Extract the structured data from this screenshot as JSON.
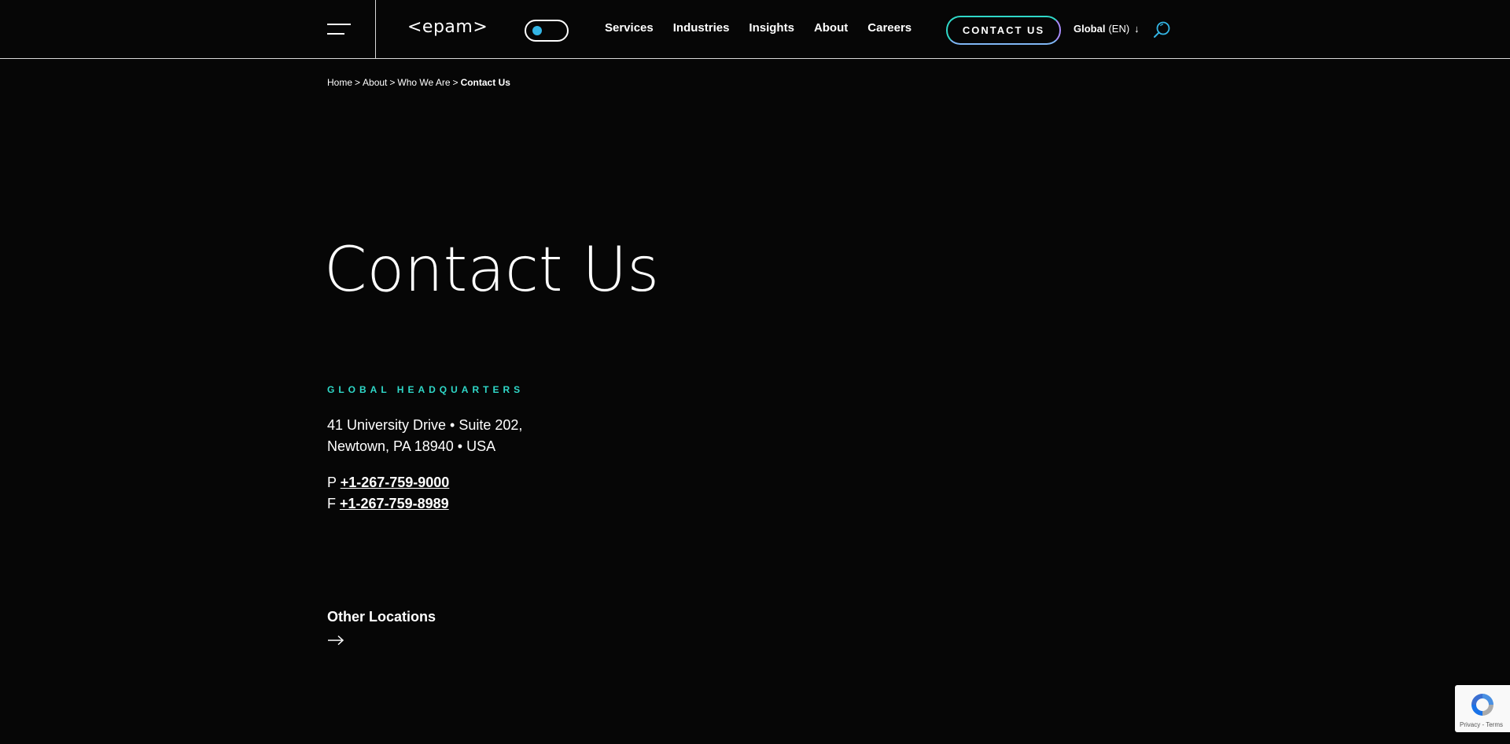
{
  "header": {
    "logo_text": "<epam>",
    "nav": [
      "Services",
      "Industries",
      "Insights",
      "About",
      "Careers"
    ],
    "contact_button": "CONTACT US",
    "language": {
      "label": "Global",
      "code": "(EN)",
      "arrow": "↓"
    },
    "icons": {
      "menu": "hamburger-menu-icon",
      "theme": "theme-toggle",
      "search": "search-icon"
    },
    "colors": {
      "accent_teal": "#2fd8c8",
      "accent_purple": "#a78bfa",
      "toggle_knob": "#33b5e5"
    }
  },
  "breadcrumb": {
    "items": [
      "Home",
      "About",
      "Who We Are"
    ],
    "current": "Contact Us",
    "separator": ">"
  },
  "main": {
    "title": "Contact Us",
    "hq_label": "GLOBAL HEADQUARTERS",
    "address_line1": "41 University Drive • Suite 202,",
    "address_line2": "Newtown, PA 18940 • USA",
    "phone_prefix": "P",
    "phone": "+1-267-759-9000",
    "fax_prefix": "F",
    "fax": "+1-267-759-8989",
    "other_locations": "Other Locations"
  },
  "recaptcha": {
    "privacy": "Privacy",
    "separator": "-",
    "terms": "Terms"
  }
}
